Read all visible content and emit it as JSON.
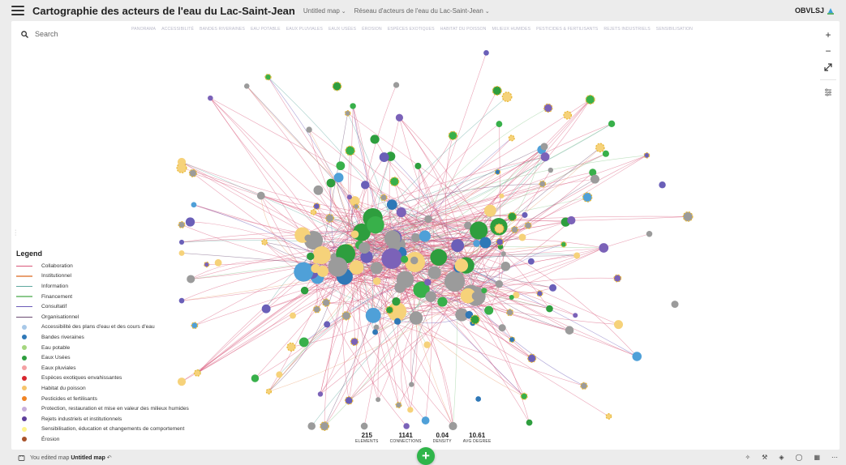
{
  "header": {
    "title": "Cartographie des acteurs de l'eau du Lac-Saint-Jean",
    "map_name": "Untitled map",
    "project_name": "Réseau d'acteurs de l'eau du Lac-Saint-Jean",
    "org": "OBVLSJ"
  },
  "search": {
    "placeholder": "Search"
  },
  "tabs": [
    "PANORAMA",
    "ACCESSIBILITÉ",
    "BANDES RIVERAINES",
    "EAU POTABLE",
    "EAUX PLUVIALES",
    "EAUX USÉES",
    "ÉROSION",
    "ESPÈCES EXOTIQUES",
    "HABITAT DU POISSON",
    "MILIEUX HUMIDES",
    "PESTICIDES & FERTILISANTS",
    "REJETS INDUSTRIELS",
    "SENSIBILISATION"
  ],
  "zoom": {
    "in": "+",
    "out": "−",
    "fit": "⤢",
    "settings": "⚙"
  },
  "legend": {
    "title": "Legend",
    "connections": [
      {
        "label": "Collaboration",
        "color": "#d9577a"
      },
      {
        "label": "Institutionnel",
        "color": "#e9a071"
      },
      {
        "label": "Information",
        "color": "#5fa89e"
      },
      {
        "label": "Financement",
        "color": "#8bc98c"
      },
      {
        "label": "Consultatif",
        "color": "#6b5bb8"
      },
      {
        "label": "Organisationnel",
        "color": "#6b4a72"
      }
    ],
    "elements": [
      {
        "label": "Accessibilité des plans d'eau et des cours d'eau",
        "color": "#a8c8e8"
      },
      {
        "label": "Bandes riveraines",
        "color": "#2f78b7"
      },
      {
        "label": "Eau potable",
        "color": "#a5d67f"
      },
      {
        "label": "Eaux Usées",
        "color": "#2e9e3e"
      },
      {
        "label": "Eaux pluviales",
        "color": "#f4a0a3"
      },
      {
        "label": "Espèces exotiques envahissantes",
        "color": "#d7262e"
      },
      {
        "label": "Habitat du poisson",
        "color": "#f6c46b"
      },
      {
        "label": "Pesticides et fertilisants",
        "color": "#f08424"
      },
      {
        "label": "Protection, restauration et mise en valeur des milieux humides",
        "color": "#c7aedb"
      },
      {
        "label": "Rejets industriels et institutionnels",
        "color": "#5d3e9a"
      },
      {
        "label": "Sensibilisation, éducation et changements de comportement",
        "color": "#fff48c"
      },
      {
        "label": "Érosion",
        "color": "#a8522a"
      }
    ]
  },
  "stats": [
    {
      "value": "215",
      "label": "ELEMENTS"
    },
    {
      "value": "1141",
      "label": "CONNECTIONS"
    },
    {
      "value": "0.04",
      "label": "DENSITY"
    },
    {
      "value": "10.61",
      "label": "AVG DEGREE"
    }
  ],
  "status": {
    "prefix": "You edited map",
    "map": "Untitled map",
    "undo_icon": "↶"
  },
  "fab": {
    "label": "+"
  },
  "tools": [
    "wand-icon",
    "wrench-icon",
    "filter-icon",
    "comment-icon",
    "table-icon",
    "more-icon"
  ]
}
